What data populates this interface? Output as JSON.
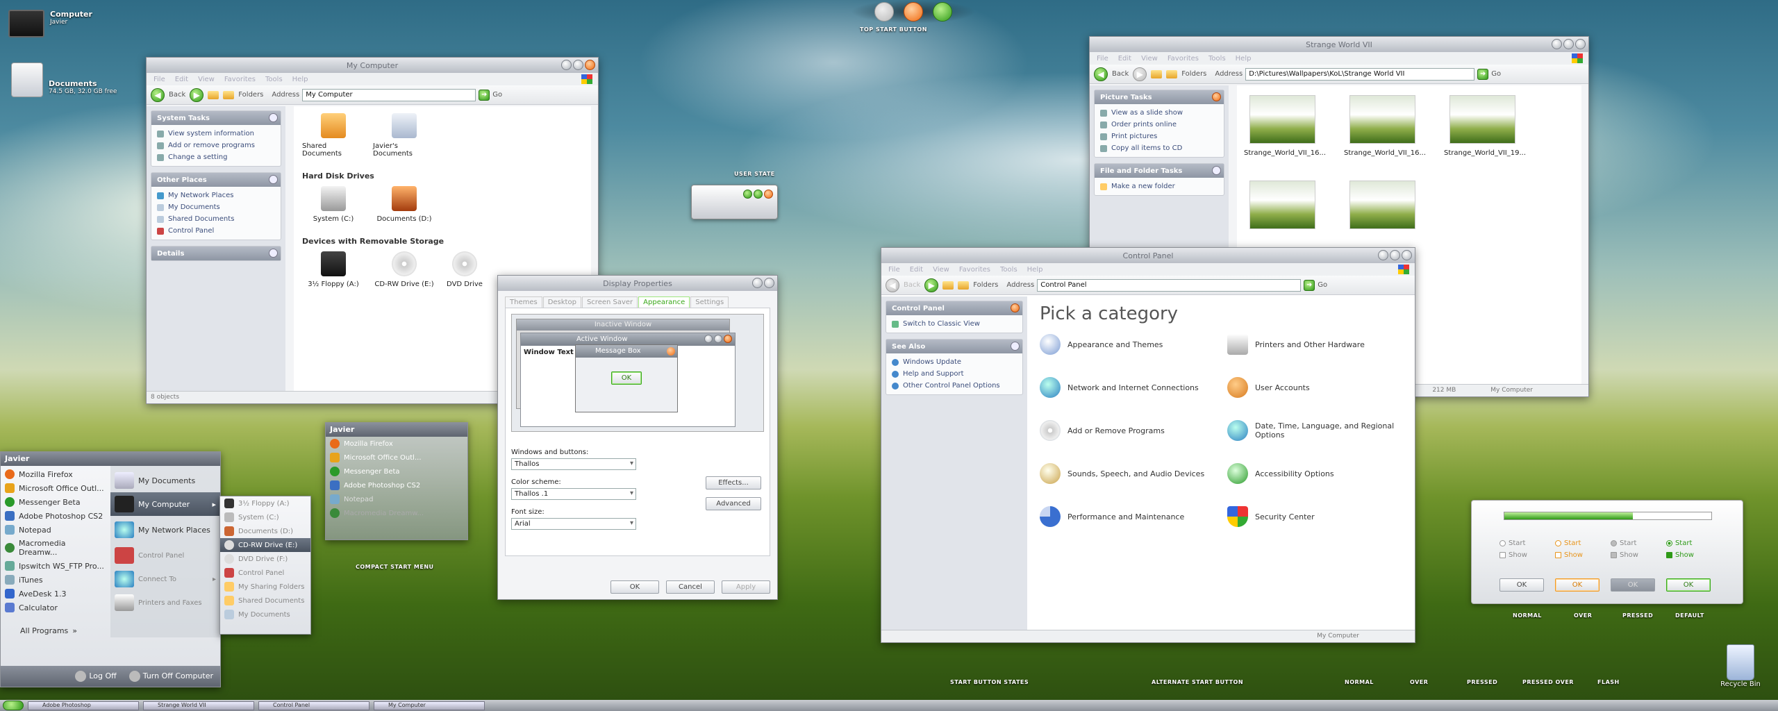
{
  "desktop": {
    "computer": {
      "title": "Computer",
      "sub": "Javier"
    },
    "documents": {
      "title": "Documents",
      "sub": "74.5 GB, 32.0 GB free"
    }
  },
  "top_start": {
    "label": "TOP START BUTTON"
  },
  "captions": {
    "user_state": "USER STATE",
    "compact": "COMPACT START MENU",
    "start_states": "START BUTTON STATES",
    "alt_start": "ALTERNATE START BUTTON",
    "normal": "NORMAL",
    "over": "OVER",
    "pressed": "PRESSED",
    "pressed_over": "PRESSED OVER",
    "flash": "FLASH",
    "normal2": "NORMAL",
    "over2": "OVER",
    "pressed2": "PRESSED",
    "default2": "DEFAULT"
  },
  "mycomputer": {
    "title": "My Computer",
    "menu": [
      "File",
      "Edit",
      "View",
      "Favorites",
      "Tools",
      "Help"
    ],
    "back": "Back",
    "folders": "Folders",
    "address_label": "Address",
    "address": "My Computer",
    "go": "Go",
    "system_tasks": {
      "title": "System Tasks",
      "items": [
        "View system information",
        "Add or remove programs",
        "Change a setting"
      ]
    },
    "other_places": {
      "title": "Other Places",
      "items": [
        "My Network Places",
        "My Documents",
        "Shared Documents",
        "Control Panel"
      ]
    },
    "details": "Details",
    "files": [
      "Shared Documents",
      "Javier's Documents"
    ],
    "hdd_title": "Hard Disk Drives",
    "hdd": [
      "System (C:)",
      "Documents (D:)"
    ],
    "removable_title": "Devices with Removable Storage",
    "removable": [
      "3½ Floppy (A:)",
      "CD-RW Drive (E:)",
      "DVD Drive"
    ],
    "status": "8 objects"
  },
  "display": {
    "title": "Display Properties",
    "tabs": [
      "Themes",
      "Desktop",
      "Screen Saver",
      "Appearance",
      "Settings"
    ],
    "inactive": "Inactive Window",
    "active": "Active Window",
    "window_text": "Window Text",
    "msgbox": "Message Box",
    "ok": "OK",
    "wb_label": "Windows and buttons:",
    "wb_value": "Thallos",
    "cs_label": "Color scheme:",
    "cs_value": "Thallos .1",
    "fs_label": "Font size:",
    "fs_value": "Arial",
    "effects": "Effects...",
    "advanced": "Advanced",
    "btn_ok": "OK",
    "btn_cancel": "Cancel",
    "btn_apply": "Apply"
  },
  "strange": {
    "title": "Strange World VII",
    "menu": [
      "File",
      "Edit",
      "View",
      "Favorites",
      "Tools",
      "Help"
    ],
    "back": "Back",
    "folders": "Folders",
    "address_label": "Address",
    "address": "D:\\Pictures\\Wallpapers\\KoL\\Strange World VII",
    "go": "Go",
    "picture_tasks": {
      "title": "Picture Tasks",
      "items": [
        "View as a slide show",
        "Order prints online",
        "Print pictures",
        "Copy all items to CD"
      ]
    },
    "file_tasks": {
      "title": "File and Folder Tasks",
      "items": [
        "Make a new folder"
      ]
    },
    "thumbs": [
      "Strange_World_VII_16...",
      "Strange_World_VII_16...",
      "Strange_World_VII_19..."
    ],
    "status_size": "212 MB",
    "status_loc": "My Computer"
  },
  "control": {
    "title": "Control Panel",
    "menu": [
      "File",
      "Edit",
      "View",
      "Favorites",
      "Tools",
      "Help"
    ],
    "back": "Back",
    "folders": "Folders",
    "address_label": "Address",
    "address": "Control Panel",
    "go": "Go",
    "cp_box": "Control Panel",
    "switch": "Switch to Classic View",
    "see_also": "See Also",
    "see_items": [
      "Windows Update",
      "Help and Support",
      "Other Control Panel Options"
    ],
    "heading": "Pick a category",
    "cats_left": [
      "Appearance and Themes",
      "Network and Internet Connections",
      "Add or Remove Programs",
      "Sounds, Speech, and Audio Devices",
      "Performance and Maintenance"
    ],
    "cats_right": [
      "Printers and Other Hardware",
      "User Accounts",
      "Date, Time, Language, and Regional Options",
      "Accessibility Options",
      "Security Center"
    ],
    "status": "My Computer"
  },
  "startmenu": {
    "user": "Javier",
    "left": [
      "Mozilla Firefox",
      "Microsoft Office Outl...",
      "Messenger Beta",
      "Adobe Photoshop CS2",
      "Notepad",
      "Macromedia Dreamw...",
      "Ipswitch WS_FTP Pro...",
      "iTunes",
      "AveDesk 1.3",
      "Calculator"
    ],
    "all": "All Programs",
    "right": [
      "My Documents",
      "My Computer",
      "My Network Places",
      "Control Panel",
      "Connect To",
      "Printers and Faxes"
    ],
    "sub": [
      "3½ Floppy (A:)",
      "System (C:)",
      "Documents (D:)",
      "CD-RW Drive (E:)",
      "DVD Drive (F:)",
      "Control Panel",
      "My Sharing Folders",
      "Shared Documents",
      "My Documents"
    ],
    "logoff": "Log Off",
    "turnoff": "Turn Off Computer"
  },
  "compact": {
    "user": "Javier",
    "items": [
      "Mozilla Firefox",
      "Microsoft Office Outl...",
      "Messenger Beta",
      "Adobe Photoshop CS2",
      "Notepad",
      "Macromedia Dreamw..."
    ]
  },
  "states": {
    "progress": 0.62,
    "rows": [
      [
        "Start",
        "Show"
      ],
      [
        "Start",
        "Show"
      ],
      [
        "Start",
        "Show"
      ],
      [
        "Start",
        "Show"
      ]
    ],
    "buttons": [
      "OK",
      "OK",
      "OK",
      "OK"
    ]
  },
  "recycle": "Recycle Bin",
  "taskbar": {
    "items": [
      "Adobe Photoshop",
      "Strange World VII",
      "Control Panel",
      "My Computer"
    ]
  }
}
